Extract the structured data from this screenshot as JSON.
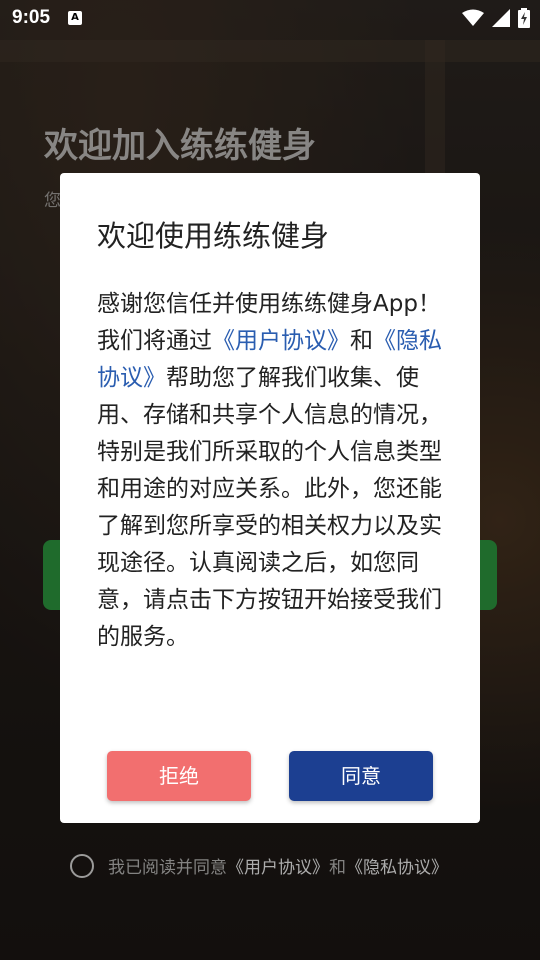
{
  "status_bar": {
    "time": "9:05",
    "notification_icon": "A"
  },
  "page": {
    "title": "欢迎加入练练健身",
    "subtitle_fragment": "您",
    "agree_prefix": "我已阅读并同意",
    "agree_link_user": "《用户协议》",
    "agree_and": "和",
    "agree_link_privacy": "《隐私协议》"
  },
  "dialog": {
    "title": "欢迎使用练练健身",
    "body_part1": "感谢您信任并使用练练健身App！我们将通过",
    "link_user": "《用户协议》",
    "body_and": "和",
    "link_privacy": "《隐私协议》",
    "body_part2": "帮助您了解我们收集、使用、存储和共享个人信息的情况，特别是我们所采取的个人信息类型和用途的对应关系。此外，您还能了解到您所享受的相关权力以及实现途径。认真阅读之后，如您同意，请点击下方按钮开始接受我们的服务。",
    "reject_label": "拒绝",
    "agree_label": "同意"
  },
  "colors": {
    "reject": "#f26f6f",
    "agree": "#1c3f91",
    "link": "#2a5db0"
  }
}
